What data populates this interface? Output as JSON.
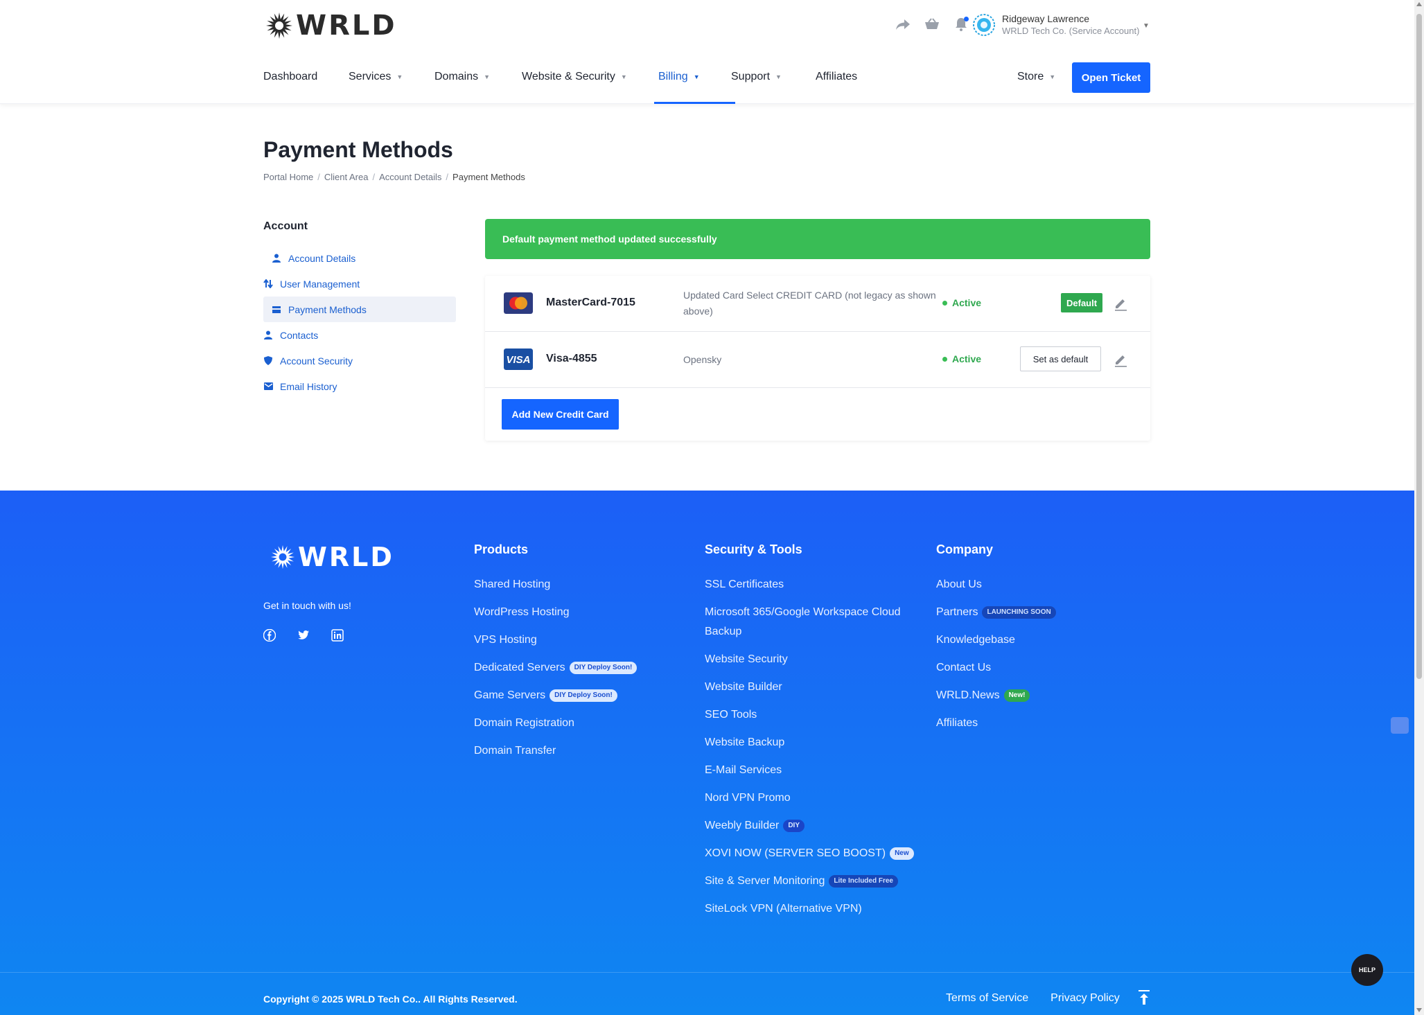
{
  "brand": {
    "name": "WRLD",
    "logo_icon": "sunburst-logo-icon"
  },
  "header": {
    "icons": [
      "share-icon",
      "basket-icon",
      "bell-icon"
    ],
    "user": {
      "name": "Ridgeway Lawrence",
      "org": "WRLD Tech Co. (Service Account)"
    }
  },
  "nav": {
    "items": [
      {
        "label": "Dashboard",
        "caret": false
      },
      {
        "label": "Services",
        "caret": true
      },
      {
        "label": "Domains",
        "caret": true
      },
      {
        "label": "Website & Security",
        "caret": true
      },
      {
        "label": "Billing",
        "caret": true,
        "active": true
      },
      {
        "label": "Support",
        "caret": true
      },
      {
        "label": "Affiliates",
        "caret": false
      }
    ],
    "store": "Store",
    "open_ticket": "Open Ticket"
  },
  "page": {
    "title": "Payment Methods",
    "breadcrumb": [
      "Portal Home",
      "Client Area",
      "Account Details",
      "Payment Methods"
    ]
  },
  "sidebar": {
    "title": "Account",
    "items": [
      {
        "label": "Account Details",
        "icon": "user-icon"
      },
      {
        "label": "User Management",
        "icon": "arrows-icon"
      },
      {
        "label": "Payment Methods",
        "icon": "card-icon",
        "active": true
      },
      {
        "label": "Contacts",
        "icon": "user-icon"
      },
      {
        "label": "Account Security",
        "icon": "shield-icon"
      },
      {
        "label": "Email History",
        "icon": "envelope-icon"
      }
    ]
  },
  "alert": {
    "text": "Default payment method updated successfully",
    "color": "#39bd55"
  },
  "payment_methods": [
    {
      "name": "MasterCard-7015",
      "brand": "mastercard",
      "description": "Updated Card Select CREDIT CARD (not legacy as shown above)",
      "status": "Active",
      "is_default": true,
      "default_label": "Default"
    },
    {
      "name": "Visa-4855",
      "brand": "visa",
      "brand_label": "VISA",
      "description": "Opensky",
      "status": "Active",
      "is_default": false,
      "set_default_label": "Set as default"
    }
  ],
  "add_card_label": "Add New Credit Card",
  "footer": {
    "tagline": "Get in touch with us!",
    "social": [
      "facebook-icon",
      "twitter-icon",
      "linkedin-icon"
    ],
    "columns": [
      {
        "title": "Products",
        "links": [
          {
            "label": "Shared Hosting"
          },
          {
            "label": "WordPress Hosting"
          },
          {
            "label": "VPS Hosting"
          },
          {
            "label": "Dedicated Servers",
            "pill": "DIY Deploy Soon!",
            "pill_style": "light"
          },
          {
            "label": "Game Servers",
            "pill": "DIY Deploy Soon!",
            "pill_style": "light"
          },
          {
            "label": "Domain Registration"
          },
          {
            "label": "Domain Transfer"
          }
        ]
      },
      {
        "title": "Security & Tools",
        "links": [
          {
            "label": "SSL Certificates"
          },
          {
            "label": "Microsoft 365/Google Workspace Cloud Backup",
            "wrap": true
          },
          {
            "label": "Website Security"
          },
          {
            "label": "Website Builder"
          },
          {
            "label": "SEO Tools"
          },
          {
            "label": "Website Backup"
          },
          {
            "label": "E-Mail Services"
          },
          {
            "label": "Nord VPN Promo"
          },
          {
            "label": "Weebly Builder",
            "pill": "DIY",
            "pill_style": "dark"
          },
          {
            "label": "XOVI NOW (SERVER SEO BOOST)",
            "pill": "New",
            "pill_style": "light"
          },
          {
            "label": "Site & Server Monitoring",
            "pill": "Lite Included Free",
            "pill_style": "navy"
          },
          {
            "label": "SiteLock VPN (Alternative VPN)"
          }
        ]
      },
      {
        "title": "Company",
        "links": [
          {
            "label": "About Us"
          },
          {
            "label": "Partners",
            "pill": "LAUNCHING SOON",
            "pill_style": "navy"
          },
          {
            "label": "Knowledgebase"
          },
          {
            "label": "Contact Us"
          },
          {
            "label": "WRLD.News",
            "pill": "New!",
            "pill_style": "green"
          },
          {
            "label": "Affiliates"
          }
        ]
      }
    ],
    "copyright": "Copyright © 2025 WRLD Tech Co.. All Rights Reserved.",
    "links": [
      "Terms of Service",
      "Privacy Policy"
    ]
  },
  "help_widget": {
    "label": "HELP"
  },
  "colors": {
    "primary": "#1565ff",
    "success": "#39bd55",
    "footer_top": "#1c5ff6",
    "footer_bottom": "#0f86f2"
  }
}
